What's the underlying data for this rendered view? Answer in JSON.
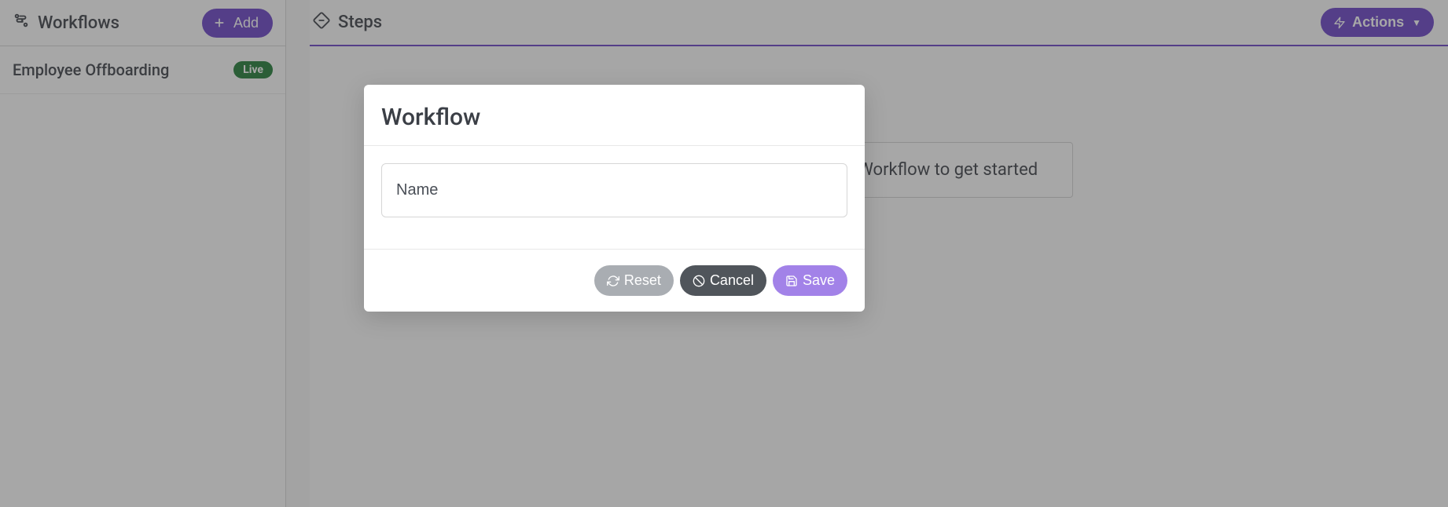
{
  "sidebar": {
    "title": "Workflows",
    "add_label": "Add",
    "items": [
      {
        "label": "Employee Offboarding",
        "badge": "Live"
      }
    ]
  },
  "main": {
    "title": "Steps",
    "actions_label": "Actions",
    "empty_state": "Select or create a Workflow to get started"
  },
  "modal": {
    "title": "Workflow",
    "name_placeholder": "Name",
    "name_value": "",
    "reset_label": "Reset",
    "cancel_label": "Cancel",
    "save_label": "Save"
  }
}
